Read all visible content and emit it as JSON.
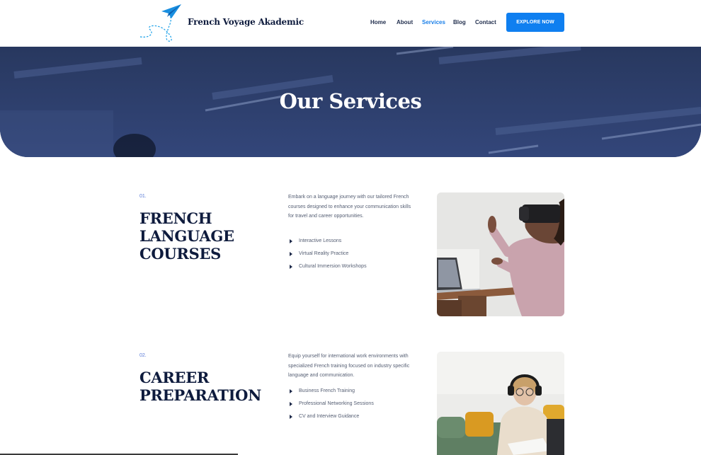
{
  "brand": {
    "name": "French Voyage Akademic"
  },
  "nav": {
    "items": [
      {
        "label": "Home",
        "active": false
      },
      {
        "label": "About",
        "active": false
      },
      {
        "label": "Services",
        "active": true
      },
      {
        "label": "Blog",
        "active": false
      },
      {
        "label": "Contact",
        "active": false
      }
    ],
    "cta_label": "EXPLORE NOW"
  },
  "hero": {
    "title": "Our Services"
  },
  "services": [
    {
      "number": "01.",
      "title_lines": [
        "FRENCH",
        "LANGUAGE",
        "COURSES"
      ],
      "description": "Embark on a language journey with our tailored French courses designed to enhance your communication skills for travel and career opportunities.",
      "features": [
        "Interactive Lessons",
        "Virtual Reality Practice",
        "Cultural Immersion Workshops"
      ]
    },
    {
      "number": "02.",
      "title_lines": [
        "CAREER",
        "PREPARATION"
      ],
      "description": "Equip yourself for international work environments with specialized French training focused on industry specific language and communication.",
      "features": [
        "Business French Training",
        "Professional Networking Sessions",
        "CV and Interview Guidance"
      ]
    }
  ],
  "colors": {
    "accent": "#0f7ff0",
    "navy": "#0e1b3d",
    "hero_overlay": "#2a3b68"
  },
  "icons": {
    "logo": "paper-plane-icon",
    "list_bullet": "triangle-right-icon"
  }
}
